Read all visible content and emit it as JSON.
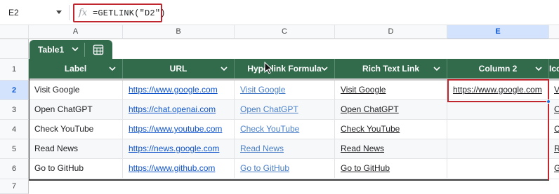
{
  "formula_bar": {
    "cell_ref": "E2",
    "fx": "fx",
    "formula": "=GETLINK(\"D2\")"
  },
  "columns": [
    "A",
    "B",
    "C",
    "D",
    "E"
  ],
  "rows": [
    "1",
    "2",
    "3",
    "4",
    "5",
    "6",
    "7"
  ],
  "table": {
    "name": "Table1",
    "headers": [
      "Label",
      "URL",
      "Hyperlink Formula",
      "Rich Text Link",
      "Column 2",
      "Ico"
    ],
    "data": [
      [
        "Visit Google",
        "https://www.google.com",
        "Visit Google",
        "Visit Google",
        "https://www.google.com",
        "V"
      ],
      [
        "Open ChatGPT",
        "https://chat.openai.com",
        "Open ChatGPT",
        "Open ChatGPT",
        "",
        "O"
      ],
      [
        "Check YouTube",
        "https://www.youtube.com",
        "Check YouTube",
        "Check YouTube",
        "",
        "C"
      ],
      [
        "Read News",
        "https://news.google.com",
        "Read News",
        "Read News",
        "",
        "R"
      ],
      [
        "Go to GitHub",
        "https://www.github.com",
        "Go to GitHub",
        "Go to GitHub",
        "",
        "G"
      ]
    ]
  },
  "colors": {
    "header_green": "#316b4c",
    "highlight_red": "#c0262d",
    "link_blue": "#1155cc"
  }
}
